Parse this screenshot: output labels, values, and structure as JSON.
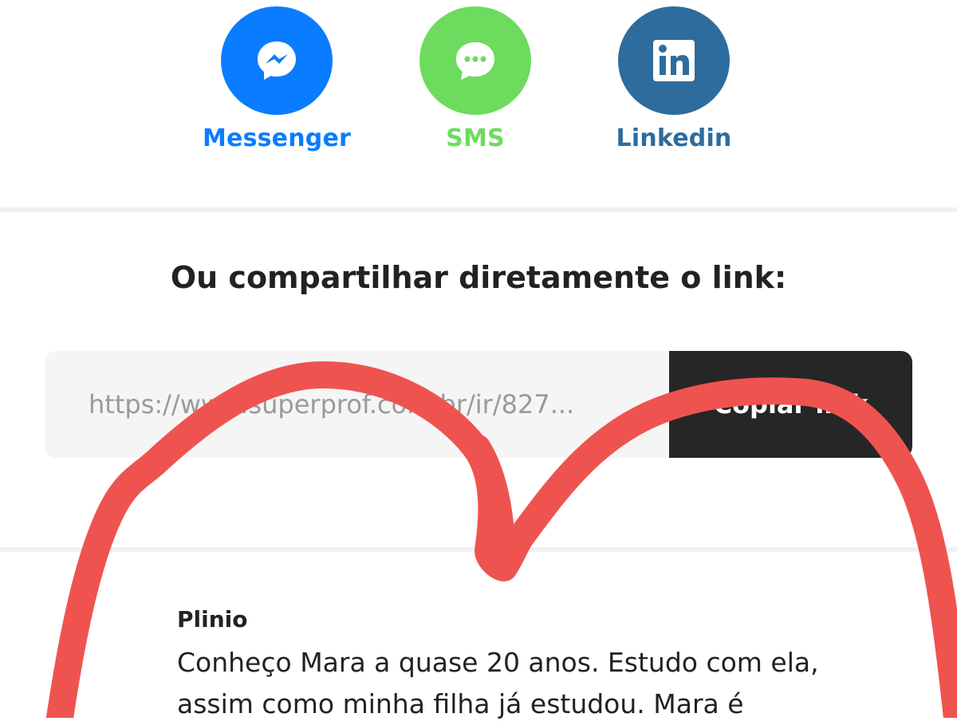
{
  "share": {
    "items": [
      {
        "label": "Messenger",
        "icon": "messenger-icon",
        "color": "#0a7cff",
        "label_color": "#0a7cff"
      },
      {
        "label": "SMS",
        "icon": "sms-chat-icon",
        "color": "#6ddb5e",
        "label_color": "#6ddb5e"
      },
      {
        "label": "Linkedin",
        "icon": "linkedin-icon",
        "color": "#2e6c9d",
        "label_color": "#2e6c9d"
      }
    ]
  },
  "link_section": {
    "heading": "Ou compartilhar diretamente o link:",
    "url_value": "https://www.superprof.com.br/ir/827...",
    "copy_label": "Copiar link",
    "button_color": "#262626"
  },
  "testimonial": {
    "author": "Plinio",
    "text": "Conheço Mara a quase 20 anos. Estudo com ela, assim como minha filha já estudou. Mara é"
  },
  "annotation": {
    "color": "#ef5350",
    "shape": "freehand-heart-stroke"
  }
}
